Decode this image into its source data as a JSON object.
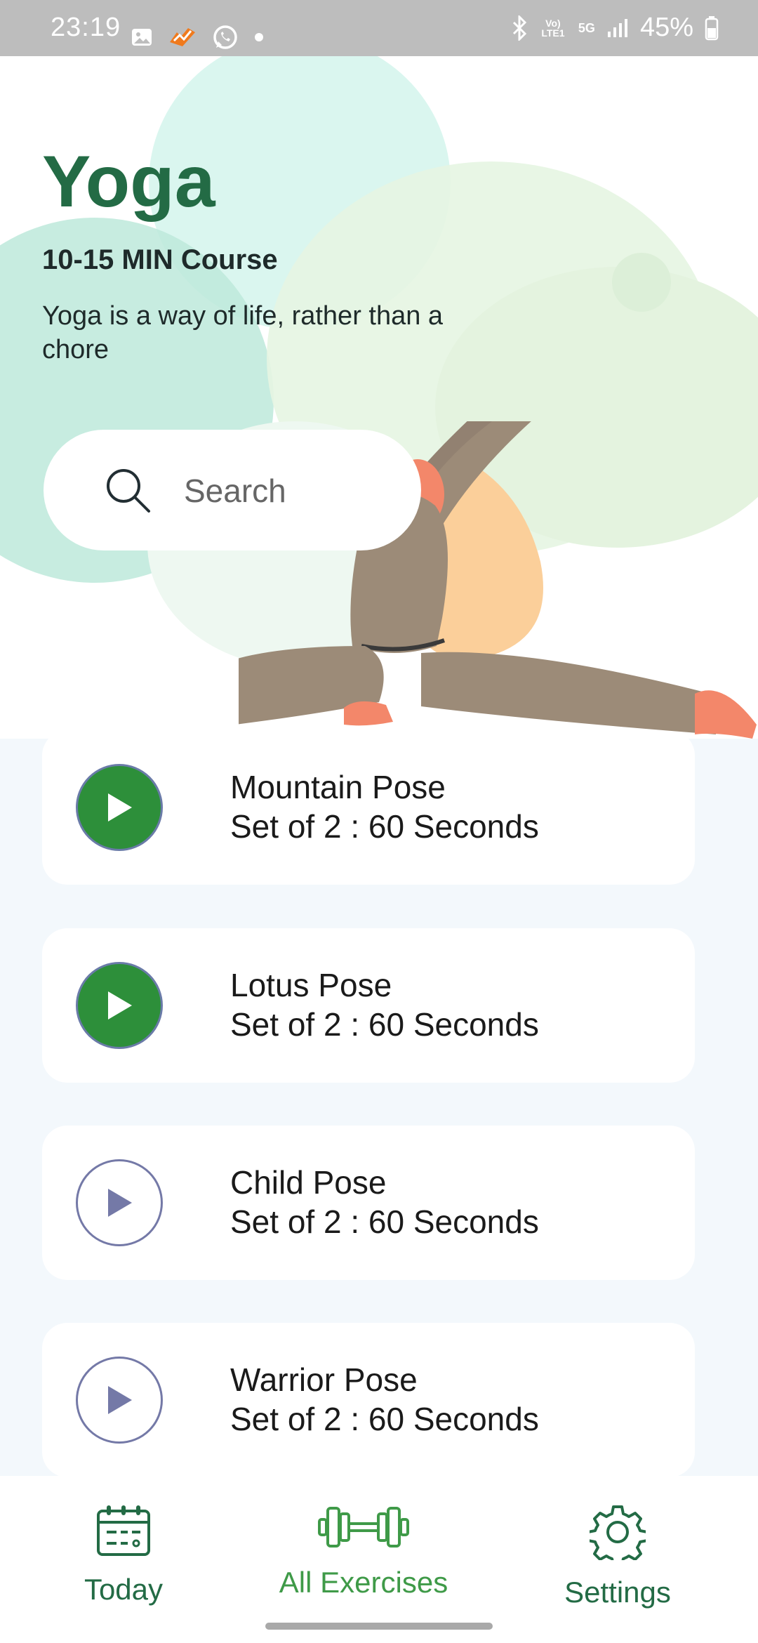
{
  "status_bar": {
    "time": "23:19",
    "lte_label": "Vo) LTE1",
    "network": "5G",
    "battery": "45%",
    "left_icons": [
      "image-icon",
      "app-notification-icon",
      "whatsapp-icon",
      "dot-icon"
    ],
    "right_icons": [
      "bluetooth-icon",
      "signal-icon",
      "battery-icon"
    ]
  },
  "hero": {
    "title": "Yoga",
    "course": "10-15 MIN Course",
    "description": "Yoga is a way of life, rather than a chore",
    "accent_color": "#236b45"
  },
  "search": {
    "placeholder": "Search",
    "value": ""
  },
  "exercises": [
    {
      "name": "Mountain Pose",
      "detail": "Set of 2 : 60 Seconds",
      "active": true
    },
    {
      "name": "Lotus Pose",
      "detail": "Set of 2 : 60 Seconds",
      "active": true
    },
    {
      "name": "Child Pose",
      "detail": "Set of 2 : 60 Seconds",
      "active": false
    },
    {
      "name": "Warrior Pose",
      "detail": "Set of 2 : 60 Seconds",
      "active": false
    }
  ],
  "colors": {
    "play_active": "#2d8f3a",
    "play_inactive_border": "#7479a7",
    "list_background": "#f3f8fc"
  },
  "bottom_nav": {
    "items": [
      {
        "label": "Today",
        "icon": "calendar-icon",
        "active": false
      },
      {
        "label": "All Exercises",
        "icon": "dumbbell-icon",
        "active": true
      },
      {
        "label": "Settings",
        "icon": "gear-icon",
        "active": false
      }
    ]
  }
}
